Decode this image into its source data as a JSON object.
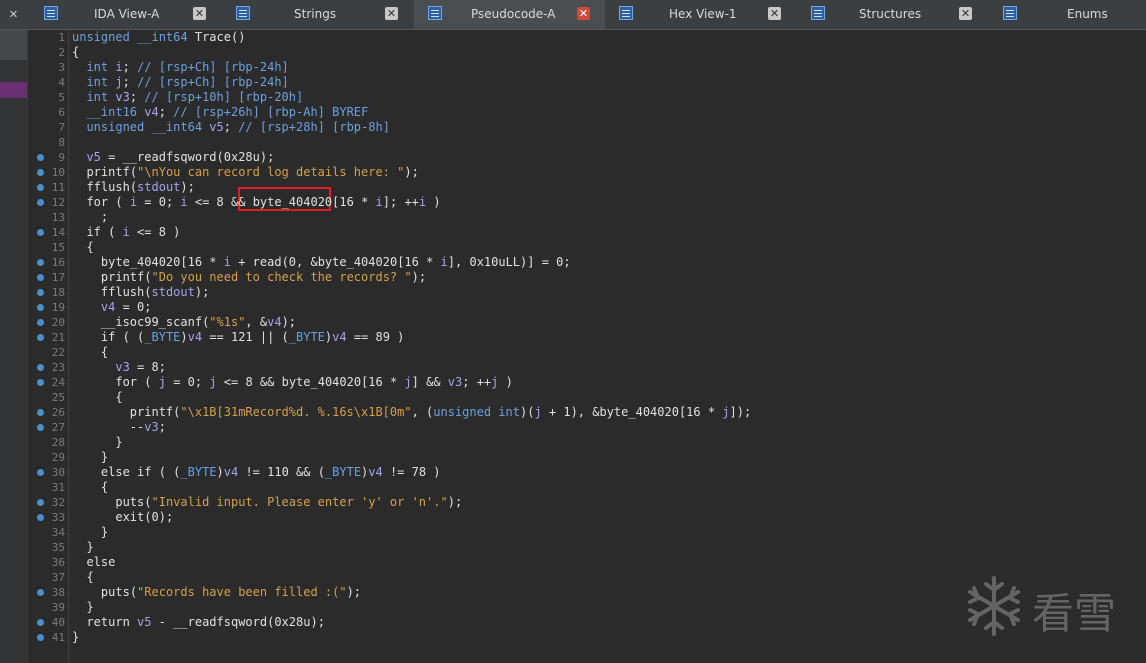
{
  "tabs": [
    {
      "label": "IDA View-A",
      "active": false,
      "icon": "ida-view-icon"
    },
    {
      "label": "Strings",
      "active": false,
      "icon": "strings-icon"
    },
    {
      "label": "Pseudocode-A",
      "active": true,
      "icon": "pseudocode-icon"
    },
    {
      "label": "Hex View-1",
      "active": false,
      "icon": "hex-view-icon"
    },
    {
      "label": "Structures",
      "active": false,
      "icon": "structures-icon"
    },
    {
      "label": "Enums",
      "active": false,
      "icon": "enums-icon"
    }
  ],
  "left_panel": {
    "close_label": "✕"
  },
  "tab_close_label": "✕",
  "colors": {
    "background": "#2b2b2b",
    "keyword": "#e0e0e0",
    "type": "#6aa0e0",
    "variable": "#a6a2ee",
    "string": "#d4a04a",
    "highlight_box": "#e02020"
  },
  "highlight": {
    "text": "byte_404020"
  },
  "watermark": {
    "text": "看雪",
    "icon": "snowflake-icon"
  },
  "code_lines": [
    {
      "n": "1",
      "bp": false,
      "text": "unsigned __int64 Trace()"
    },
    {
      "n": "2",
      "bp": false,
      "text": "{"
    },
    {
      "n": "3",
      "bp": false,
      "text": "  int i; // [rsp+Ch] [rbp-24h]"
    },
    {
      "n": "4",
      "bp": false,
      "text": "  int j; // [rsp+Ch] [rbp-24h]"
    },
    {
      "n": "5",
      "bp": false,
      "text": "  int v3; // [rsp+10h] [rbp-20h]"
    },
    {
      "n": "6",
      "bp": false,
      "text": "  __int16 v4; // [rsp+26h] [rbp-Ah] BYREF"
    },
    {
      "n": "7",
      "bp": false,
      "text": "  unsigned __int64 v5; // [rsp+28h] [rbp-8h]"
    },
    {
      "n": "8",
      "bp": false,
      "text": ""
    },
    {
      "n": "9",
      "bp": true,
      "text": "  v5 = __readfsqword(0x28u);"
    },
    {
      "n": "10",
      "bp": true,
      "text": "  printf(\"\\nYou can record log details here: \");"
    },
    {
      "n": "11",
      "bp": true,
      "text": "  fflush(stdout);"
    },
    {
      "n": "12",
      "bp": true,
      "text": "  for ( i = 0; i <= 8 && byte_404020[16 * i]; ++i )"
    },
    {
      "n": "13",
      "bp": false,
      "text": "    ;"
    },
    {
      "n": "14",
      "bp": true,
      "text": "  if ( i <= 8 )"
    },
    {
      "n": "15",
      "bp": false,
      "text": "  {"
    },
    {
      "n": "16",
      "bp": true,
      "text": "    byte_404020[16 * i + read(0, &byte_404020[16 * i], 0x10uLL)] = 0;"
    },
    {
      "n": "17",
      "bp": true,
      "text": "    printf(\"Do you need to check the records? \");"
    },
    {
      "n": "18",
      "bp": true,
      "text": "    fflush(stdout);"
    },
    {
      "n": "19",
      "bp": true,
      "text": "    v4 = 0;"
    },
    {
      "n": "20",
      "bp": true,
      "text": "    __isoc99_scanf(\"%1s\", &v4);"
    },
    {
      "n": "21",
      "bp": true,
      "text": "    if ( (_BYTE)v4 == 121 || (_BYTE)v4 == 89 )"
    },
    {
      "n": "22",
      "bp": false,
      "text": "    {"
    },
    {
      "n": "23",
      "bp": true,
      "text": "      v3 = 8;"
    },
    {
      "n": "24",
      "bp": true,
      "text": "      for ( j = 0; j <= 8 && byte_404020[16 * j] && v3; ++j )"
    },
    {
      "n": "25",
      "bp": false,
      "text": "      {"
    },
    {
      "n": "26",
      "bp": true,
      "text": "        printf(\"\\x1B[31mRecord%d. %.16s\\x1B[0m\", (unsigned int)(j + 1), &byte_404020[16 * j]);"
    },
    {
      "n": "27",
      "bp": true,
      "text": "        --v3;"
    },
    {
      "n": "28",
      "bp": false,
      "text": "      }"
    },
    {
      "n": "29",
      "bp": false,
      "text": "    }"
    },
    {
      "n": "30",
      "bp": true,
      "text": "    else if ( (_BYTE)v4 != 110 && (_BYTE)v4 != 78 )"
    },
    {
      "n": "31",
      "bp": false,
      "text": "    {"
    },
    {
      "n": "32",
      "bp": true,
      "text": "      puts(\"Invalid input. Please enter 'y' or 'n'.\");"
    },
    {
      "n": "33",
      "bp": true,
      "text": "      exit(0);"
    },
    {
      "n": "34",
      "bp": false,
      "text": "    }"
    },
    {
      "n": "35",
      "bp": false,
      "text": "  }"
    },
    {
      "n": "36",
      "bp": false,
      "text": "  else"
    },
    {
      "n": "37",
      "bp": false,
      "text": "  {"
    },
    {
      "n": "38",
      "bp": true,
      "text": "    puts(\"Records have been filled :(\");"
    },
    {
      "n": "39",
      "bp": false,
      "text": "  }"
    },
    {
      "n": "40",
      "bp": true,
      "text": "  return v5 - __readfsqword(0x28u);"
    },
    {
      "n": "41",
      "bp": true,
      "text": "}"
    }
  ]
}
